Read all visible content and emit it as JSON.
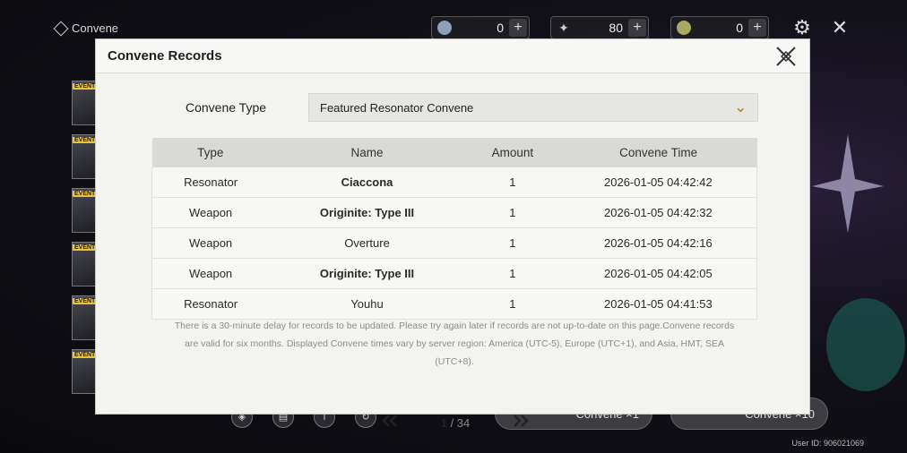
{
  "background": {
    "title": "Convene",
    "currencies": [
      {
        "icon": "astrite-icon",
        "value": "0"
      },
      {
        "icon": "lunite-icon",
        "value": "80"
      },
      {
        "icon": "tide-icon",
        "value": "0"
      }
    ],
    "banner_tag": "EVENT",
    "pull_buttons": [
      "Convene ×1",
      "Convene ×10"
    ],
    "user_id": "User ID: 906021069"
  },
  "modal": {
    "title": "Convene Records",
    "convene_type_label": "Convene Type",
    "convene_type_value": "Featured Resonator Convene",
    "columns": [
      "Type",
      "Name",
      "Amount",
      "Convene Time"
    ],
    "records": [
      {
        "type": "Resonator",
        "name": "Ciaccona",
        "amount": "1",
        "time": "2026-01-05 04:42:42",
        "rarity": "five"
      },
      {
        "type": "Weapon",
        "name": "Originite: Type III",
        "amount": "1",
        "time": "2026-01-05 04:42:32",
        "rarity": "four"
      },
      {
        "type": "Weapon",
        "name": "Overture",
        "amount": "1",
        "time": "2026-01-05 04:42:16",
        "rarity": "three"
      },
      {
        "type": "Weapon",
        "name": "Originite: Type III",
        "amount": "1",
        "time": "2026-01-05 04:42:05",
        "rarity": "four"
      },
      {
        "type": "Resonator",
        "name": "Youhu",
        "amount": "1",
        "time": "2026-01-05 04:41:53",
        "rarity": "three"
      }
    ],
    "notice": "There is a 30-minute delay for records to be updated. Please try again later if records are not up-to-date on this page.Convene records are valid for six months. Displayed Convene times vary by server region: America (UTC-5), Europe (UTC+1), and Asia, HMT, SEA (UTC+8).",
    "pager": {
      "current": "1",
      "total": "/ 34"
    }
  },
  "colors": {
    "five_star": "#d4a021",
    "modal_bg": "#f4f4f1"
  }
}
